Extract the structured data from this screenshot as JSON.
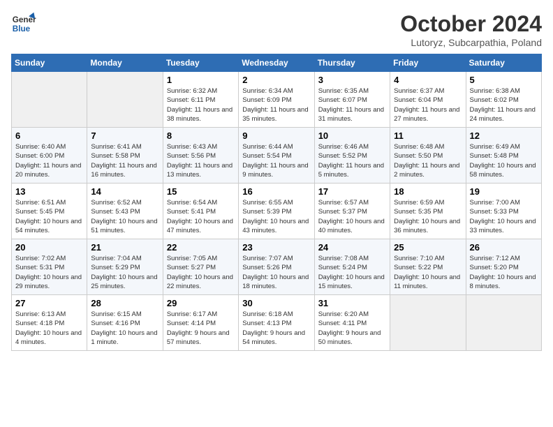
{
  "header": {
    "logo_line1": "General",
    "logo_line2": "Blue",
    "month": "October 2024",
    "location": "Lutoryz, Subcarpathia, Poland"
  },
  "weekdays": [
    "Sunday",
    "Monday",
    "Tuesday",
    "Wednesday",
    "Thursday",
    "Friday",
    "Saturday"
  ],
  "weeks": [
    [
      {
        "day": "",
        "sunrise": "",
        "sunset": "",
        "daylight": ""
      },
      {
        "day": "",
        "sunrise": "",
        "sunset": "",
        "daylight": ""
      },
      {
        "day": "1",
        "sunrise": "Sunrise: 6:32 AM",
        "sunset": "Sunset: 6:11 PM",
        "daylight": "Daylight: 11 hours and 38 minutes."
      },
      {
        "day": "2",
        "sunrise": "Sunrise: 6:34 AM",
        "sunset": "Sunset: 6:09 PM",
        "daylight": "Daylight: 11 hours and 35 minutes."
      },
      {
        "day": "3",
        "sunrise": "Sunrise: 6:35 AM",
        "sunset": "Sunset: 6:07 PM",
        "daylight": "Daylight: 11 hours and 31 minutes."
      },
      {
        "day": "4",
        "sunrise": "Sunrise: 6:37 AM",
        "sunset": "Sunset: 6:04 PM",
        "daylight": "Daylight: 11 hours and 27 minutes."
      },
      {
        "day": "5",
        "sunrise": "Sunrise: 6:38 AM",
        "sunset": "Sunset: 6:02 PM",
        "daylight": "Daylight: 11 hours and 24 minutes."
      }
    ],
    [
      {
        "day": "6",
        "sunrise": "Sunrise: 6:40 AM",
        "sunset": "Sunset: 6:00 PM",
        "daylight": "Daylight: 11 hours and 20 minutes."
      },
      {
        "day": "7",
        "sunrise": "Sunrise: 6:41 AM",
        "sunset": "Sunset: 5:58 PM",
        "daylight": "Daylight: 11 hours and 16 minutes."
      },
      {
        "day": "8",
        "sunrise": "Sunrise: 6:43 AM",
        "sunset": "Sunset: 5:56 PM",
        "daylight": "Daylight: 11 hours and 13 minutes."
      },
      {
        "day": "9",
        "sunrise": "Sunrise: 6:44 AM",
        "sunset": "Sunset: 5:54 PM",
        "daylight": "Daylight: 11 hours and 9 minutes."
      },
      {
        "day": "10",
        "sunrise": "Sunrise: 6:46 AM",
        "sunset": "Sunset: 5:52 PM",
        "daylight": "Daylight: 11 hours and 5 minutes."
      },
      {
        "day": "11",
        "sunrise": "Sunrise: 6:48 AM",
        "sunset": "Sunset: 5:50 PM",
        "daylight": "Daylight: 11 hours and 2 minutes."
      },
      {
        "day": "12",
        "sunrise": "Sunrise: 6:49 AM",
        "sunset": "Sunset: 5:48 PM",
        "daylight": "Daylight: 10 hours and 58 minutes."
      }
    ],
    [
      {
        "day": "13",
        "sunrise": "Sunrise: 6:51 AM",
        "sunset": "Sunset: 5:45 PM",
        "daylight": "Daylight: 10 hours and 54 minutes."
      },
      {
        "day": "14",
        "sunrise": "Sunrise: 6:52 AM",
        "sunset": "Sunset: 5:43 PM",
        "daylight": "Daylight: 10 hours and 51 minutes."
      },
      {
        "day": "15",
        "sunrise": "Sunrise: 6:54 AM",
        "sunset": "Sunset: 5:41 PM",
        "daylight": "Daylight: 10 hours and 47 minutes."
      },
      {
        "day": "16",
        "sunrise": "Sunrise: 6:55 AM",
        "sunset": "Sunset: 5:39 PM",
        "daylight": "Daylight: 10 hours and 43 minutes."
      },
      {
        "day": "17",
        "sunrise": "Sunrise: 6:57 AM",
        "sunset": "Sunset: 5:37 PM",
        "daylight": "Daylight: 10 hours and 40 minutes."
      },
      {
        "day": "18",
        "sunrise": "Sunrise: 6:59 AM",
        "sunset": "Sunset: 5:35 PM",
        "daylight": "Daylight: 10 hours and 36 minutes."
      },
      {
        "day": "19",
        "sunrise": "Sunrise: 7:00 AM",
        "sunset": "Sunset: 5:33 PM",
        "daylight": "Daylight: 10 hours and 33 minutes."
      }
    ],
    [
      {
        "day": "20",
        "sunrise": "Sunrise: 7:02 AM",
        "sunset": "Sunset: 5:31 PM",
        "daylight": "Daylight: 10 hours and 29 minutes."
      },
      {
        "day": "21",
        "sunrise": "Sunrise: 7:04 AM",
        "sunset": "Sunset: 5:29 PM",
        "daylight": "Daylight: 10 hours and 25 minutes."
      },
      {
        "day": "22",
        "sunrise": "Sunrise: 7:05 AM",
        "sunset": "Sunset: 5:27 PM",
        "daylight": "Daylight: 10 hours and 22 minutes."
      },
      {
        "day": "23",
        "sunrise": "Sunrise: 7:07 AM",
        "sunset": "Sunset: 5:26 PM",
        "daylight": "Daylight: 10 hours and 18 minutes."
      },
      {
        "day": "24",
        "sunrise": "Sunrise: 7:08 AM",
        "sunset": "Sunset: 5:24 PM",
        "daylight": "Daylight: 10 hours and 15 minutes."
      },
      {
        "day": "25",
        "sunrise": "Sunrise: 7:10 AM",
        "sunset": "Sunset: 5:22 PM",
        "daylight": "Daylight: 10 hours and 11 minutes."
      },
      {
        "day": "26",
        "sunrise": "Sunrise: 7:12 AM",
        "sunset": "Sunset: 5:20 PM",
        "daylight": "Daylight: 10 hours and 8 minutes."
      }
    ],
    [
      {
        "day": "27",
        "sunrise": "Sunrise: 6:13 AM",
        "sunset": "Sunset: 4:18 PM",
        "daylight": "Daylight: 10 hours and 4 minutes."
      },
      {
        "day": "28",
        "sunrise": "Sunrise: 6:15 AM",
        "sunset": "Sunset: 4:16 PM",
        "daylight": "Daylight: 10 hours and 1 minute."
      },
      {
        "day": "29",
        "sunrise": "Sunrise: 6:17 AM",
        "sunset": "Sunset: 4:14 PM",
        "daylight": "Daylight: 9 hours and 57 minutes."
      },
      {
        "day": "30",
        "sunrise": "Sunrise: 6:18 AM",
        "sunset": "Sunset: 4:13 PM",
        "daylight": "Daylight: 9 hours and 54 minutes."
      },
      {
        "day": "31",
        "sunrise": "Sunrise: 6:20 AM",
        "sunset": "Sunset: 4:11 PM",
        "daylight": "Daylight: 9 hours and 50 minutes."
      },
      {
        "day": "",
        "sunrise": "",
        "sunset": "",
        "daylight": ""
      },
      {
        "day": "",
        "sunrise": "",
        "sunset": "",
        "daylight": ""
      }
    ]
  ]
}
